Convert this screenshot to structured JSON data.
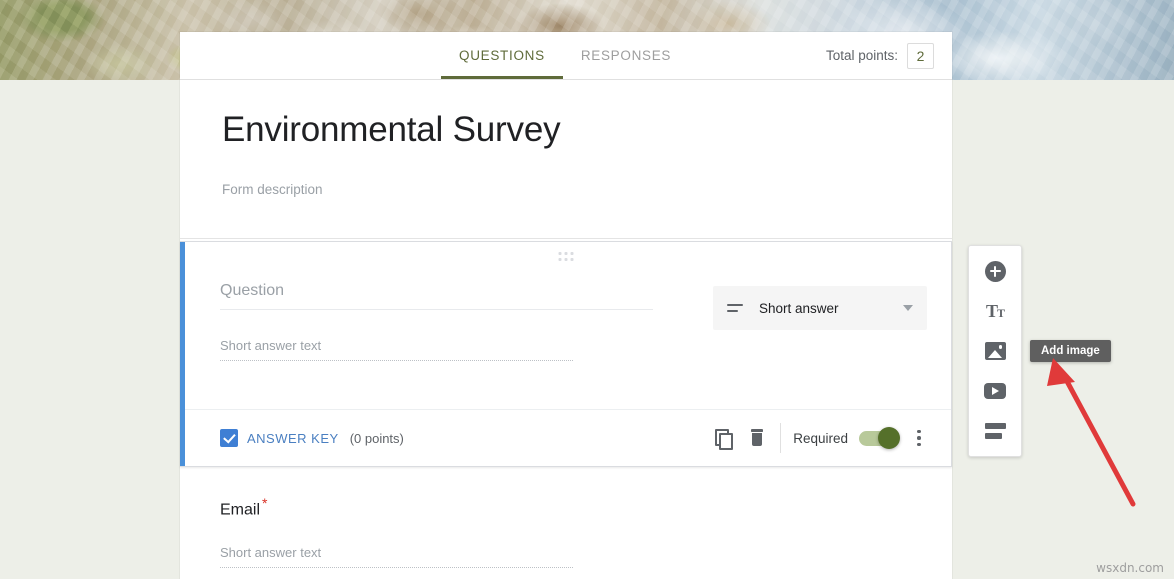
{
  "banner": {
    "alt": "rocky-riverbank-photo"
  },
  "tabbar": {
    "tabs": [
      {
        "label": "QUESTIONS",
        "active": true
      },
      {
        "label": "RESPONSES",
        "active": false
      }
    ],
    "points_label": "Total points:",
    "points_value": "2"
  },
  "form": {
    "title": "Environmental Survey",
    "description_placeholder": "Form description"
  },
  "question": {
    "title_placeholder": "Question",
    "answer_placeholder": "Short answer text",
    "type_label": "Short answer",
    "answer_key_label": "ANSWER KEY",
    "answer_key_points": "(0 points)",
    "required_label": "Required",
    "required_on": true
  },
  "email_question": {
    "title": "Email",
    "required_marker": "*",
    "answer_placeholder": "Short answer text"
  },
  "side_toolbar": {
    "items": [
      {
        "name": "add-question",
        "icon": "add-circle-icon"
      },
      {
        "name": "add-title-description",
        "icon": "title-text-icon"
      },
      {
        "name": "add-image",
        "icon": "image-icon"
      },
      {
        "name": "add-video",
        "icon": "video-icon"
      },
      {
        "name": "add-section",
        "icon": "section-icon"
      }
    ]
  },
  "tooltip": {
    "text": "Add image"
  },
  "annotation": {
    "arrow_color": "#e03a3a"
  },
  "watermark": {
    "text": "wsxdn.com"
  },
  "colors": {
    "accent_green": "#5f6b3a",
    "card_accent_blue": "#4a90d9",
    "answer_key_blue": "#3f7fd4",
    "required_toggle_green": "#55702a",
    "page_background": "#edefe8",
    "required_marker_red": "#d93025"
  }
}
